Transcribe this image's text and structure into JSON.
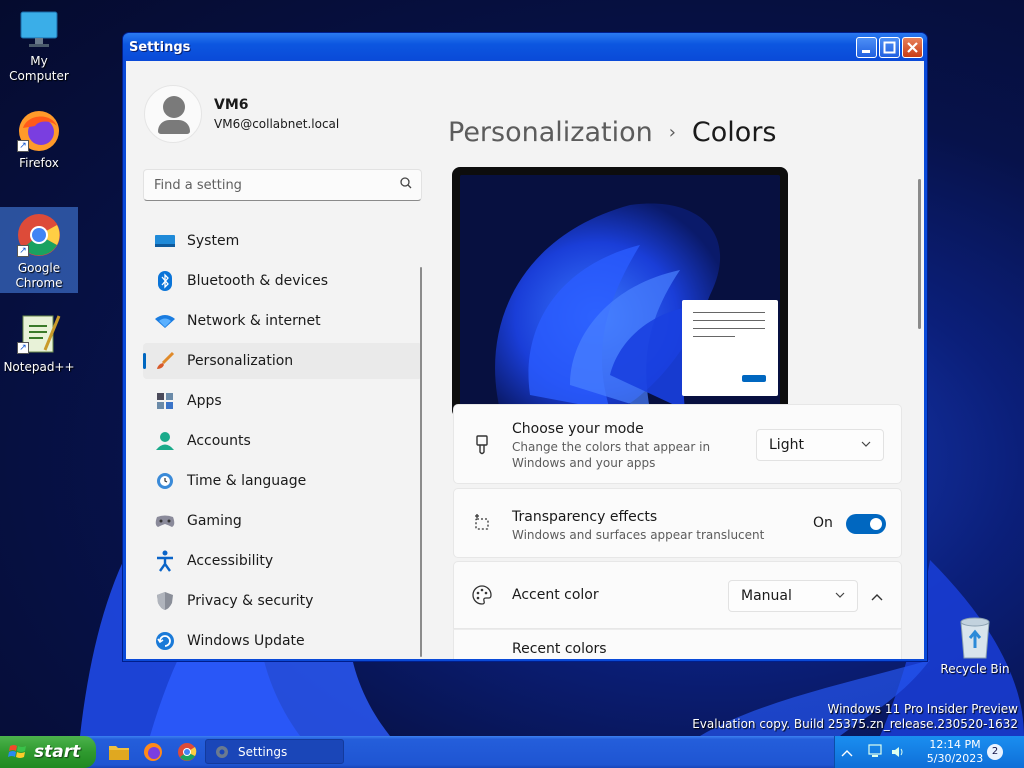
{
  "desktop": {
    "icons": [
      {
        "label": "My Computer",
        "icon": "computer-icon"
      },
      {
        "label": "Firefox",
        "icon": "firefox-icon"
      },
      {
        "label": "Google Chrome",
        "icon": "chrome-icon"
      },
      {
        "label": "Notepad++",
        "icon": "notepadpp-icon"
      },
      {
        "label": "Recycle Bin",
        "icon": "recycle-bin-icon"
      }
    ],
    "watermark": {
      "line1": "Windows 11 Pro Insider Preview",
      "line2": "Evaluation copy. Build 25375.zn_release.230520-1632"
    }
  },
  "window": {
    "title": "Settings",
    "buttons": [
      "minimize",
      "maximize",
      "close"
    ]
  },
  "profile": {
    "name": "VM6",
    "email": "VM6@collabnet.local"
  },
  "search": {
    "placeholder": "Find a setting"
  },
  "nav": {
    "items": [
      {
        "label": "System",
        "icon": "system-icon"
      },
      {
        "label": "Bluetooth & devices",
        "icon": "bluetooth-icon"
      },
      {
        "label": "Network & internet",
        "icon": "wifi-icon"
      },
      {
        "label": "Personalization",
        "icon": "brush-icon",
        "active": true
      },
      {
        "label": "Apps",
        "icon": "apps-icon"
      },
      {
        "label": "Accounts",
        "icon": "accounts-icon"
      },
      {
        "label": "Time & language",
        "icon": "time-language-icon"
      },
      {
        "label": "Gaming",
        "icon": "gaming-icon"
      },
      {
        "label": "Accessibility",
        "icon": "accessibility-icon"
      },
      {
        "label": "Privacy & security",
        "icon": "shield-icon"
      },
      {
        "label": "Windows Update",
        "icon": "update-icon"
      }
    ]
  },
  "breadcrumb": {
    "parent": "Personalization",
    "separator": "›",
    "current": "Colors"
  },
  "settings": {
    "mode": {
      "title": "Choose your mode",
      "desc1": "Change the colors that appear in",
      "desc2": "Windows and your apps",
      "value": "Light"
    },
    "transparency": {
      "title": "Transparency effects",
      "desc": "Windows and surfaces appear translucent",
      "state": "On"
    },
    "accent": {
      "title": "Accent color",
      "value": "Manual"
    },
    "recent": {
      "title": "Recent colors"
    }
  },
  "taskbar": {
    "start_label": "start",
    "task_label": "Settings",
    "time": "12:14 PM",
    "date": "5/30/2023",
    "notification_count": "2"
  },
  "colors": {
    "accent": "#0067c0",
    "xp_title": "#0a4ad8",
    "start_green": "#2f9a2f"
  }
}
